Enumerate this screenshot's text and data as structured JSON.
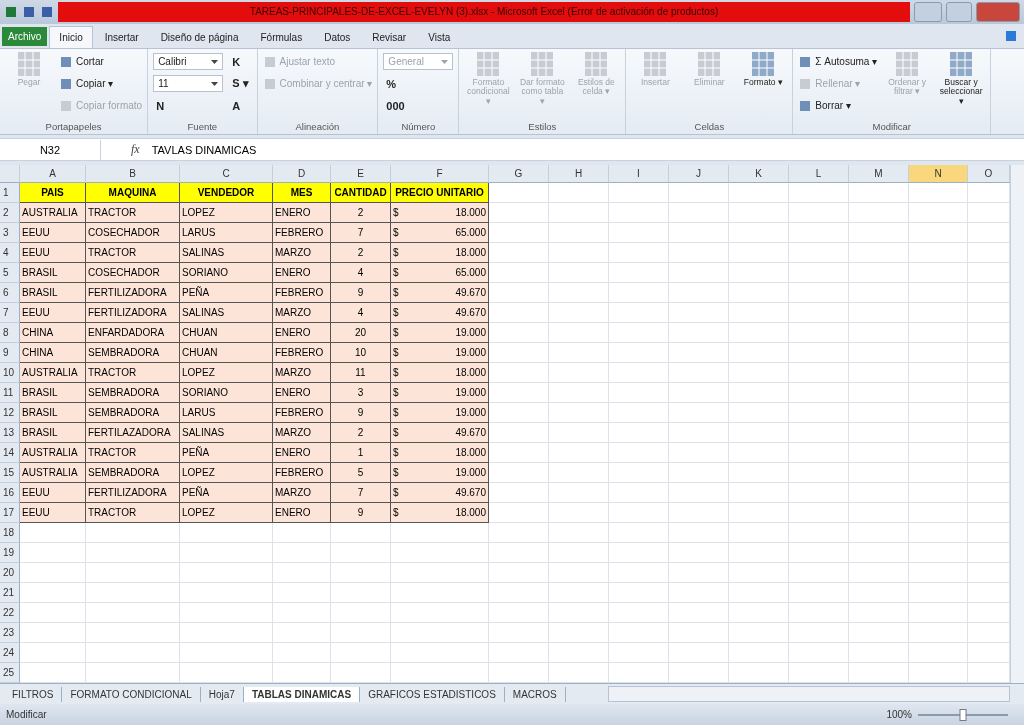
{
  "window": {
    "title": "TAREAS-PRINCIPALES-DE-EXCEL-EVELYN (3).xlsx - Microsoft Excel (Error de activación de productos)"
  },
  "file_tab": "Archivo",
  "ribbon_tabs": [
    {
      "label": "Inicio",
      "selected": true
    },
    {
      "label": "Insertar",
      "selected": false
    },
    {
      "label": "Diseño de página",
      "selected": false
    },
    {
      "label": "Fórmulas",
      "selected": false
    },
    {
      "label": "Datos",
      "selected": false
    },
    {
      "label": "Revisar",
      "selected": false
    },
    {
      "label": "Vista",
      "selected": false
    }
  ],
  "ribbon_groups": [
    {
      "label": "Portapapeles",
      "items": [
        {
          "kind": "big",
          "label": "Pegar",
          "disabled": true
        },
        {
          "kind": "small",
          "label": "Cortar",
          "disabled": false
        },
        {
          "kind": "small",
          "label": "Copiar ▾",
          "disabled": false
        },
        {
          "kind": "small",
          "label": "Copiar formato",
          "disabled": true
        }
      ]
    },
    {
      "label": "Fuente",
      "items": [
        {
          "kind": "field",
          "label": "Calibri",
          "disabled": false
        },
        {
          "kind": "field",
          "label": "11",
          "disabled": false
        },
        {
          "kind": "glyph",
          "label": "N",
          "disabled": false
        },
        {
          "kind": "glyph",
          "label": "K",
          "disabled": false
        },
        {
          "kind": "glyph",
          "label": "S ▾",
          "disabled": false
        },
        {
          "kind": "glyph",
          "label": "A",
          "disabled": false
        }
      ]
    },
    {
      "label": "Alineación",
      "items": [
        {
          "kind": "small",
          "label": "Ajustar texto",
          "disabled": true
        },
        {
          "kind": "small",
          "label": "Combinar y centrar ▾",
          "disabled": true
        }
      ]
    },
    {
      "label": "Número",
      "items": [
        {
          "kind": "field",
          "label": "General",
          "disabled": true
        },
        {
          "kind": "glyph",
          "label": "%",
          "disabled": false
        },
        {
          "kind": "glyph",
          "label": "000",
          "disabled": false
        }
      ]
    },
    {
      "label": "Estilos",
      "items": [
        {
          "kind": "big",
          "label": "Formato condicional ▾",
          "disabled": true
        },
        {
          "kind": "big",
          "label": "Dar formato como tabla ▾",
          "disabled": true
        },
        {
          "kind": "big",
          "label": "Estilos de celda ▾",
          "disabled": true
        }
      ]
    },
    {
      "label": "Celdas",
      "items": [
        {
          "kind": "big",
          "label": "Insertar",
          "disabled": true
        },
        {
          "kind": "big",
          "label": "Eliminar",
          "disabled": true
        },
        {
          "kind": "big",
          "label": "Formato ▾",
          "disabled": false
        }
      ]
    },
    {
      "label": "Modificar",
      "items": [
        {
          "kind": "small",
          "label": "Σ Autosuma ▾",
          "disabled": false
        },
        {
          "kind": "small",
          "label": "Rellenar ▾",
          "disabled": true
        },
        {
          "kind": "small",
          "label": "Borrar ▾",
          "disabled": false
        },
        {
          "kind": "big",
          "label": "Ordenar y filtrar ▾",
          "disabled": true
        },
        {
          "kind": "big",
          "label": "Buscar y seleccionar ▾",
          "disabled": false
        }
      ]
    }
  ],
  "name_box": "N32",
  "function_label": "fx",
  "formula": "TAVLAS DINAMICAS",
  "columns": [
    {
      "label": "A",
      "selected": false
    },
    {
      "label": "B",
      "selected": false
    },
    {
      "label": "C",
      "selected": false
    },
    {
      "label": "D",
      "selected": false
    },
    {
      "label": "E",
      "selected": false
    },
    {
      "label": "F",
      "selected": false
    },
    {
      "label": "G",
      "selected": false
    },
    {
      "label": "H",
      "selected": false
    },
    {
      "label": "I",
      "selected": false
    },
    {
      "label": "J",
      "selected": false
    },
    {
      "label": "K",
      "selected": false
    },
    {
      "label": "L",
      "selected": false
    },
    {
      "label": "M",
      "selected": false
    },
    {
      "label": "N",
      "selected": true
    },
    {
      "label": "O",
      "selected": false
    }
  ],
  "rows": [
    {
      "number": "1",
      "kind": "header",
      "cells": [
        "PAIS",
        "MAQUINA",
        "VENDEDOR",
        "MES",
        "CANTIDAD",
        "PRECIO UNITARIO"
      ]
    },
    {
      "number": "2",
      "kind": "data",
      "cells": [
        "AUSTRALIA",
        "TRACTOR",
        "LOPEZ",
        "ENERO",
        "2",
        "$",
        "18.000"
      ]
    },
    {
      "number": "3",
      "kind": "data",
      "cells": [
        "EEUU",
        "COSECHADOR",
        "LARUS",
        "FEBRERO",
        "7",
        "$",
        "65.000"
      ]
    },
    {
      "number": "4",
      "kind": "data",
      "cells": [
        "EEUU",
        "TRACTOR",
        "SALINAS",
        "MARZO",
        "2",
        "$",
        "18.000"
      ]
    },
    {
      "number": "5",
      "kind": "data",
      "cells": [
        "BRASIL",
        "COSECHADOR",
        "SORIANO",
        "ENERO",
        "4",
        "$",
        "65.000"
      ]
    },
    {
      "number": "6",
      "kind": "data",
      "cells": [
        "BRASIL",
        "FERTILIZADORA",
        "PEÑA",
        "FEBRERO",
        "9",
        "$",
        "49.670"
      ]
    },
    {
      "number": "7",
      "kind": "data",
      "cells": [
        "EEUU",
        "FERTILIZADORA",
        "SALINAS",
        "MARZO",
        "4",
        "$",
        "49.670"
      ]
    },
    {
      "number": "8",
      "kind": "data",
      "cells": [
        "CHINA",
        "ENFARDADORA",
        "CHUAN",
        "ENERO",
        "20",
        "$",
        "19.000"
      ]
    },
    {
      "number": "9",
      "kind": "data",
      "cells": [
        "CHINA",
        "SEMBRADORA",
        "CHUAN",
        "FEBRERO",
        "10",
        "$",
        "19.000"
      ]
    },
    {
      "number": "10",
      "kind": "data",
      "cells": [
        "AUSTRALIA",
        "TRACTOR",
        "LOPEZ",
        "MARZO",
        "11",
        "$",
        "18.000"
      ]
    },
    {
      "number": "11",
      "kind": "data",
      "cells": [
        "BRASIL",
        "SEMBRADORA",
        "SORIANO",
        "ENERO",
        "3",
        "$",
        "19.000"
      ]
    },
    {
      "number": "12",
      "kind": "data",
      "cells": [
        "BRASIL",
        "SEMBRADORA",
        "LARUS",
        "FEBRERO",
        "9",
        "$",
        "19.000"
      ]
    },
    {
      "number": "13",
      "kind": "data",
      "cells": [
        "BRASIL",
        "FERTILAZADORA",
        "SALINAS",
        "MARZO",
        "2",
        "$",
        "49.670"
      ]
    },
    {
      "number": "14",
      "kind": "data",
      "cells": [
        "AUSTRALIA",
        "TRACTOR",
        "PEÑA",
        "ENERO",
        "1",
        "$",
        "18.000"
      ]
    },
    {
      "number": "15",
      "kind": "data",
      "cells": [
        "AUSTRALIA",
        "SEMBRADORA",
        "LOPEZ",
        "FEBRERO",
        "5",
        "$",
        "19.000"
      ]
    },
    {
      "number": "16",
      "kind": "data",
      "cells": [
        "EEUU",
        "FERTILIZADORA",
        "PEÑA",
        "MARZO",
        "7",
        "$",
        "49.670"
      ]
    },
    {
      "number": "17",
      "kind": "data",
      "cells": [
        "EEUU",
        "TRACTOR",
        "LOPEZ",
        "ENERO",
        "9",
        "$",
        "18.000"
      ]
    },
    {
      "number": "18",
      "kind": "empty"
    },
    {
      "number": "19",
      "kind": "empty"
    },
    {
      "number": "20",
      "kind": "empty"
    },
    {
      "number": "21",
      "kind": "empty"
    },
    {
      "number": "22",
      "kind": "empty"
    },
    {
      "number": "23",
      "kind": "empty"
    },
    {
      "number": "24",
      "kind": "empty"
    },
    {
      "number": "25",
      "kind": "empty"
    }
  ],
  "sheet_tabs": [
    {
      "label": "FILTROS",
      "selected": false
    },
    {
      "label": "FORMATO CONDICIONAL",
      "selected": false
    },
    {
      "label": "Hoja7",
      "selected": false
    },
    {
      "label": "TABLAS DINAMICAS",
      "selected": true
    },
    {
      "label": "GRAFICOS ESTADISTICOS",
      "selected": false
    },
    {
      "label": "MACROS",
      "selected": false
    }
  ],
  "status_bar": {
    "mode": "Modificar",
    "zoom": "100%",
    "zoom_slider": {
      "level": 0.5
    }
  }
}
